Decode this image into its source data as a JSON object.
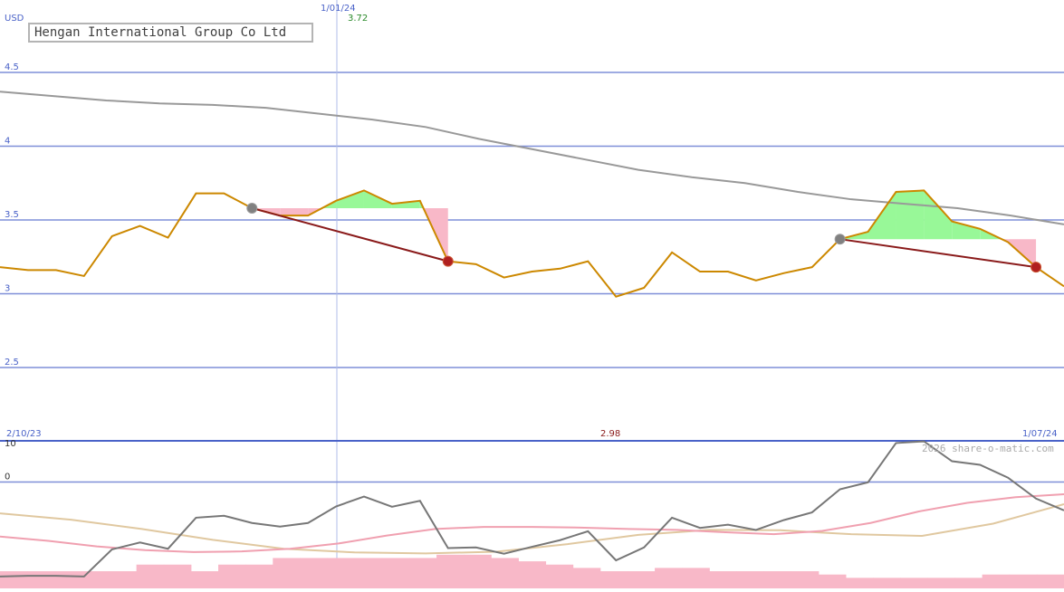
{
  "chart_data": [
    {
      "type": "line",
      "title": "Hengan International Group Co Ltd",
      "ylabel": "USD",
      "ylim": [
        2.4,
        4.8
      ],
      "yticks": [
        "4.5",
        "4",
        "3.5",
        "3",
        "2.5"
      ],
      "date_start": "2/10/23",
      "date_end": "1/07/24",
      "marker_date": "1/01/24",
      "marker_value": "3.72",
      "low_value": "2.98",
      "grid": true,
      "series": [
        {
          "color": "#cc8800",
          "values": [
            3.18,
            3.16,
            3.16,
            3.12,
            3.39,
            3.46,
            3.38,
            3.68,
            3.68,
            3.58,
            3.53,
            3.53,
            3.63,
            3.7,
            3.61,
            3.63,
            3.22,
            3.2,
            3.11,
            3.15,
            3.17,
            3.22,
            2.98,
            3.04,
            3.28,
            3.15,
            3.15,
            3.09,
            3.14,
            3.18,
            3.37,
            3.42,
            3.69,
            3.7,
            3.49,
            3.44,
            3.35,
            3.18,
            3.05
          ]
        },
        {
          "color": "#999999",
          "values": [
            4.37,
            4.34,
            4.31,
            4.29,
            4.28,
            4.26,
            4.22,
            4.18,
            4.13,
            4.05,
            3.98,
            3.91,
            3.84,
            3.79,
            3.75,
            3.69,
            3.64,
            3.61,
            3.58,
            3.53,
            3.47
          ]
        }
      ],
      "trade_segments": [
        {
          "from": [
            9,
            3.58
          ],
          "to": [
            16,
            3.22
          ]
        },
        {
          "from": [
            30,
            3.37
          ],
          "to": [
            37,
            3.18
          ]
        }
      ]
    },
    {
      "type": "line",
      "ylim": [
        -30,
        10
      ],
      "yticks": [
        "10",
        "0",
        "-30"
      ],
      "credit": "2026 share-o-matic.com",
      "series": [
        {
          "color": "#777777",
          "values": [
            -28.6,
            -28.4,
            -28.4,
            -28.6,
            -20.4,
            -18.3,
            -20.2,
            -10.8,
            -10.2,
            -12.4,
            -13.5,
            -12.4,
            -7.4,
            -4.4,
            -7.5,
            -5.7,
            -20.0,
            -19.8,
            -21.7,
            -19.6,
            -17.6,
            -14.9,
            -23.7,
            -19.8,
            -10.8,
            -13.9,
            -12.9,
            -14.5,
            -11.5,
            -9.2,
            -2.2,
            -0.1,
            11.8,
            12.3,
            6.3,
            5.2,
            1.3,
            -5.0,
            -8.6
          ]
        },
        {
          "color": "#f0a0b0",
          "values": [
            -16.5,
            -17.8,
            -19.5,
            -20.6,
            -21.2,
            -21.0,
            -20.2,
            -18.6,
            -16.2,
            -14.2,
            -13.6,
            -13.6,
            -13.8,
            -14.2,
            -14.5,
            -15.2,
            -15.8,
            -14.8,
            -12.4,
            -8.9,
            -6.3,
            -4.6,
            -3.7
          ]
        },
        {
          "color": "#e0c8a0",
          "values": [
            -9.5,
            -11.4,
            -14.2,
            -17.5,
            -20.2,
            -21.3,
            -21.6,
            -21.1,
            -18.8,
            -16.0,
            -14.5,
            -14.6,
            -15.8,
            -16.3,
            -12.6,
            -6.7
          ]
        }
      ],
      "bars": [
        -3,
        -3,
        -3,
        -3,
        -3,
        -5,
        -5,
        -3,
        -5,
        -5,
        -7,
        -7,
        -7,
        -7,
        -7,
        -7,
        -8,
        -8,
        -7,
        -6,
        -5,
        -4,
        -3,
        -3,
        -4,
        -4,
        -3,
        -3,
        -3,
        -3,
        -2,
        -1,
        -1,
        -1,
        -1,
        -1,
        -2,
        -2,
        -2
      ]
    }
  ]
}
